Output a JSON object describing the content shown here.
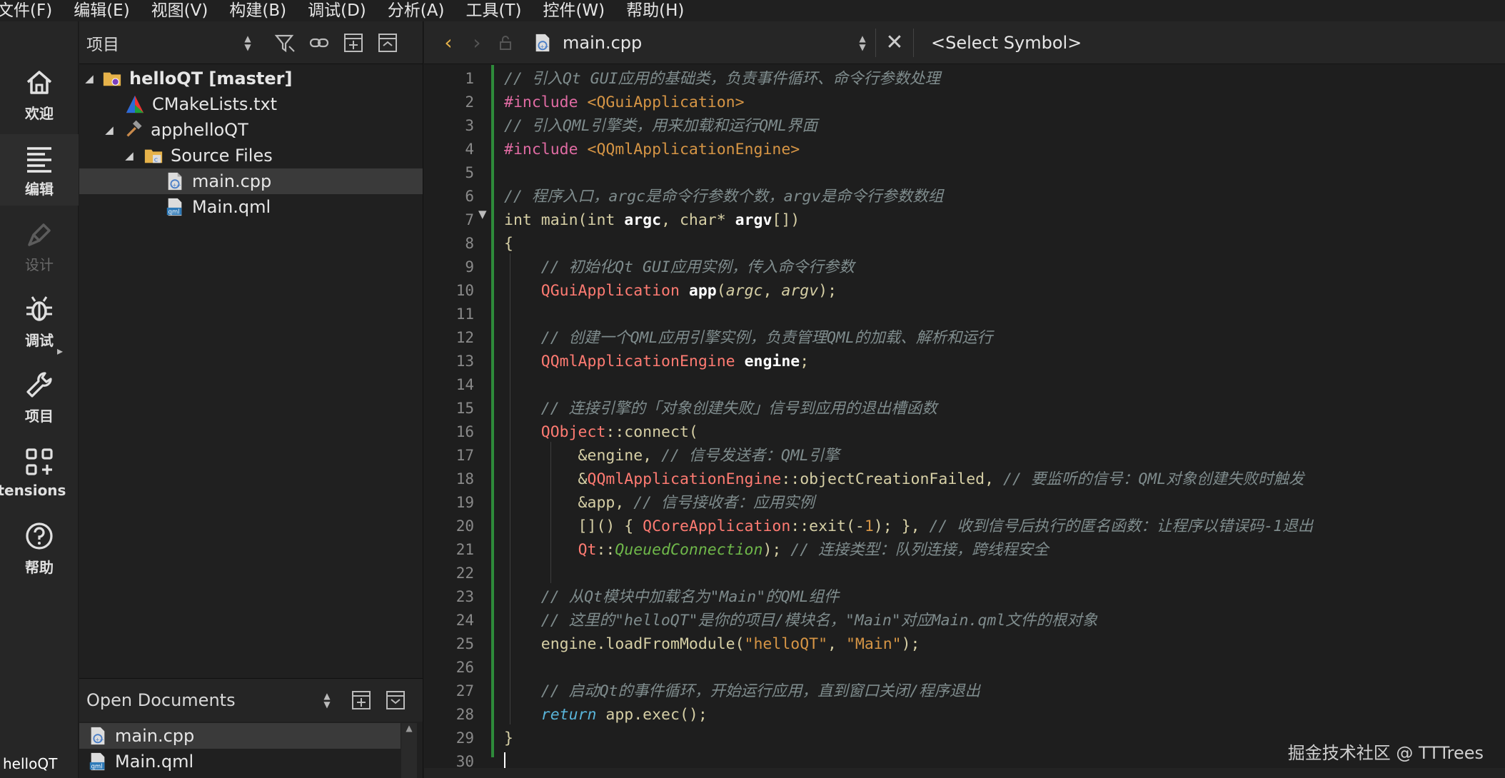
{
  "menu": [
    "文件(F)",
    "编辑(E)",
    "视图(V)",
    "构建(B)",
    "调试(D)",
    "分析(A)",
    "工具(T)",
    "控件(W)",
    "帮助(H)"
  ],
  "modes": [
    {
      "label": "欢迎",
      "icon": "home-icon",
      "enabled": true
    },
    {
      "label": "编辑",
      "icon": "edit-lines-icon",
      "enabled": true
    },
    {
      "label": "设计",
      "icon": "pen-icon",
      "enabled": false
    },
    {
      "label": "调试",
      "icon": "bug-icon",
      "enabled": true
    },
    {
      "label": "项目",
      "icon": "wrench-icon",
      "enabled": true
    },
    {
      "label": "xtensions",
      "icon": "extensions-icon",
      "enabled": true
    },
    {
      "label": "帮助",
      "icon": "help-icon",
      "enabled": true
    }
  ],
  "project_mini": "helloQT",
  "project_pane": {
    "title": "项目",
    "tree": [
      {
        "label": "helloQT [master]",
        "level": 0,
        "expanded": true,
        "icon": "project-folder-icon",
        "bold": true
      },
      {
        "label": "CMakeLists.txt",
        "level": 1,
        "icon": "cmake-icon"
      },
      {
        "label": "apphelloQT",
        "level": 1,
        "expanded": true,
        "icon": "hammer-icon"
      },
      {
        "label": "Source Files",
        "level": 2,
        "expanded": true,
        "icon": "source-folder-icon"
      },
      {
        "label": "main.cpp",
        "level": 3,
        "icon": "cpp-file-icon",
        "selected": true
      },
      {
        "label": "Main.qml",
        "level": 3,
        "icon": "qml-file-icon"
      }
    ]
  },
  "open_docs": {
    "title": "Open Documents",
    "items": [
      {
        "label": "main.cpp",
        "icon": "cpp-file-icon",
        "selected": true
      },
      {
        "label": "Main.qml",
        "icon": "qml-file-icon"
      }
    ]
  },
  "editor_toolbar": {
    "filename": "main.cpp",
    "symbol": "<Select Symbol>"
  },
  "code": {
    "line_numbers": [
      "1",
      "2",
      "3",
      "4",
      "5",
      "6",
      "7",
      "8",
      "9",
      "10",
      "11",
      "12",
      "13",
      "14",
      "15",
      "16",
      "17",
      "18",
      "19",
      "20",
      "21",
      "22",
      "23",
      "24",
      "25",
      "26",
      "27",
      "28",
      "29",
      "30"
    ],
    "lines": [
      [
        [
          "c-cm",
          "// 引入Qt GUI应用的基础类，负责事件循环、命令行参数处理"
        ]
      ],
      [
        [
          "c-pp",
          "#include "
        ],
        [
          "c-inc",
          "<QGuiApplication>"
        ]
      ],
      [
        [
          "c-cm",
          "// 引入QML引擎类，用来加载和运行QML界面"
        ]
      ],
      [
        [
          "c-pp",
          "#include "
        ],
        [
          "c-inc",
          "<QQmlApplicationEngine>"
        ]
      ],
      [],
      [
        [
          "c-cm",
          "// 程序入口，argc是命令行参数个数，argv是命令行参数数组"
        ]
      ],
      [
        [
          "c-kw",
          "int "
        ],
        [
          "c-plain",
          "main("
        ],
        [
          "c-kw",
          "int "
        ],
        [
          "c-fn",
          "argc"
        ],
        [
          "c-plain",
          ", "
        ],
        [
          "c-kw",
          "char"
        ],
        [
          "c-plain",
          "* "
        ],
        [
          "c-fn",
          "argv"
        ],
        [
          "c-plain",
          "[])"
        ]
      ],
      [
        [
          "c-plain",
          "{"
        ]
      ],
      [
        [
          "c-plain",
          "    "
        ],
        [
          "c-cm",
          "// 初始化Qt GUI应用实例，传入命令行参数"
        ]
      ],
      [
        [
          "c-plain",
          "    "
        ],
        [
          "c-type",
          "QGuiApplication "
        ],
        [
          "c-fn",
          "app"
        ],
        [
          "c-plain",
          "("
        ],
        [
          "c-var",
          "argc"
        ],
        [
          "c-plain",
          ", "
        ],
        [
          "c-var",
          "argv"
        ],
        [
          "c-plain",
          ");"
        ]
      ],
      [],
      [
        [
          "c-plain",
          "    "
        ],
        [
          "c-cm",
          "// 创建一个QML应用引擎实例，负责管理QML的加载、解析和运行"
        ]
      ],
      [
        [
          "c-plain",
          "    "
        ],
        [
          "c-type",
          "QQmlApplicationEngine "
        ],
        [
          "c-fn",
          "engine"
        ],
        [
          "c-plain",
          ";"
        ]
      ],
      [],
      [
        [
          "c-plain",
          "    "
        ],
        [
          "c-cm",
          "// 连接引擎的「对象创建失败」信号到应用的退出槽函数"
        ]
      ],
      [
        [
          "c-plain",
          "    "
        ],
        [
          "c-type",
          "QObject"
        ],
        [
          "c-plain",
          "::connect("
        ]
      ],
      [
        [
          "c-plain",
          "        &engine, "
        ],
        [
          "c-cm",
          "// 信号发送者：QML引擎"
        ]
      ],
      [
        [
          "c-plain",
          "        &"
        ],
        [
          "c-type",
          "QQmlApplicationEngine"
        ],
        [
          "c-plain",
          "::objectCreationFailed, "
        ],
        [
          "c-cm",
          "// 要监听的信号：QML对象创建失败时触发"
        ]
      ],
      [
        [
          "c-plain",
          "        &app, "
        ],
        [
          "c-cm",
          "// 信号接收者：应用实例"
        ]
      ],
      [
        [
          "c-plain",
          "        []() { "
        ],
        [
          "c-type",
          "QCoreApplication"
        ],
        [
          "c-plain",
          "::exit(-"
        ],
        [
          "c-num",
          "1"
        ],
        [
          "c-plain",
          "); }, "
        ],
        [
          "c-cm",
          "// 收到信号后执行的匿名函数：让程序以错误码-1退出"
        ]
      ],
      [
        [
          "c-plain",
          "        "
        ],
        [
          "c-type",
          "Qt"
        ],
        [
          "c-plain",
          "::"
        ],
        [
          "c-enum",
          "QueuedConnection"
        ],
        [
          "c-plain",
          "); "
        ],
        [
          "c-cm",
          "// 连接类型：队列连接，跨线程安全"
        ]
      ],
      [],
      [
        [
          "c-plain",
          "    "
        ],
        [
          "c-cm",
          "// 从Qt模块中加载名为\"Main\"的QML组件"
        ]
      ],
      [
        [
          "c-plain",
          "    "
        ],
        [
          "c-cm",
          "// 这里的\"helloQT\"是你的项目/模块名，\"Main\"对应Main.qml文件的根对象"
        ]
      ],
      [
        [
          "c-plain",
          "    engine.loadFromModule("
        ],
        [
          "c-str",
          "\"helloQT\""
        ],
        [
          "c-plain",
          ", "
        ],
        [
          "c-str",
          "\"Main\""
        ],
        [
          "c-plain",
          ");"
        ]
      ],
      [],
      [
        [
          "c-plain",
          "    "
        ],
        [
          "c-cm",
          "// 启动Qt的事件循环，开始运行应用，直到窗口关闭/程序退出"
        ]
      ],
      [
        [
          "c-plain",
          "    "
        ],
        [
          "c-ret",
          "return "
        ],
        [
          "c-plain",
          "app.exec();"
        ]
      ],
      [
        [
          "c-plain",
          "}"
        ]
      ],
      []
    ]
  },
  "watermark": "掘金技术社区 @ TTTrees"
}
